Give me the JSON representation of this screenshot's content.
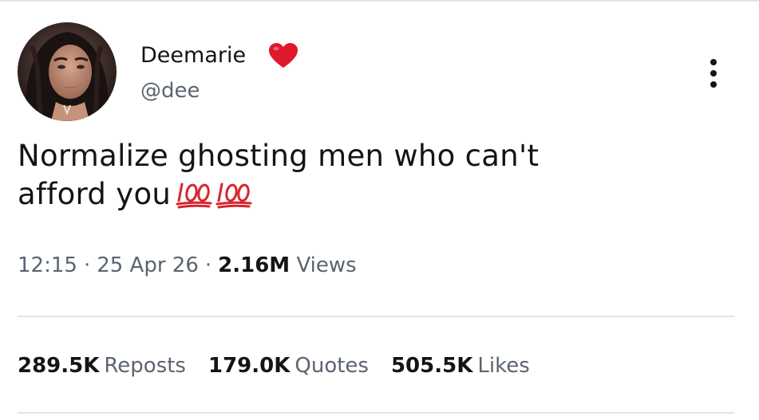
{
  "header": {
    "display_name": "Deemarie",
    "handle": "@dee",
    "heart_icon": "red-heart-emoji",
    "more_icon": "vertical-ellipsis"
  },
  "tweet": {
    "line1": "Normalize ghosting men who can't",
    "line2": "afford you",
    "emoji": [
      "hundred-points-emoji",
      "hundred-points-emoji"
    ]
  },
  "meta": {
    "time": "12:15",
    "separator": "·",
    "date": "25 Apr 26",
    "views_count": "2.16M",
    "views_label": "Views"
  },
  "stats": {
    "reposts_count": "289.5K",
    "reposts_label": "Reposts",
    "quotes_count": "179.0K",
    "quotes_label": "Quotes",
    "likes_count": "505.5K",
    "likes_label": "Likes"
  },
  "colors": {
    "text": "#141414",
    "secondary": "#5b6470",
    "divider": "#e3e3e3",
    "heart": "#e0182d",
    "hundred": "#d8252c"
  }
}
